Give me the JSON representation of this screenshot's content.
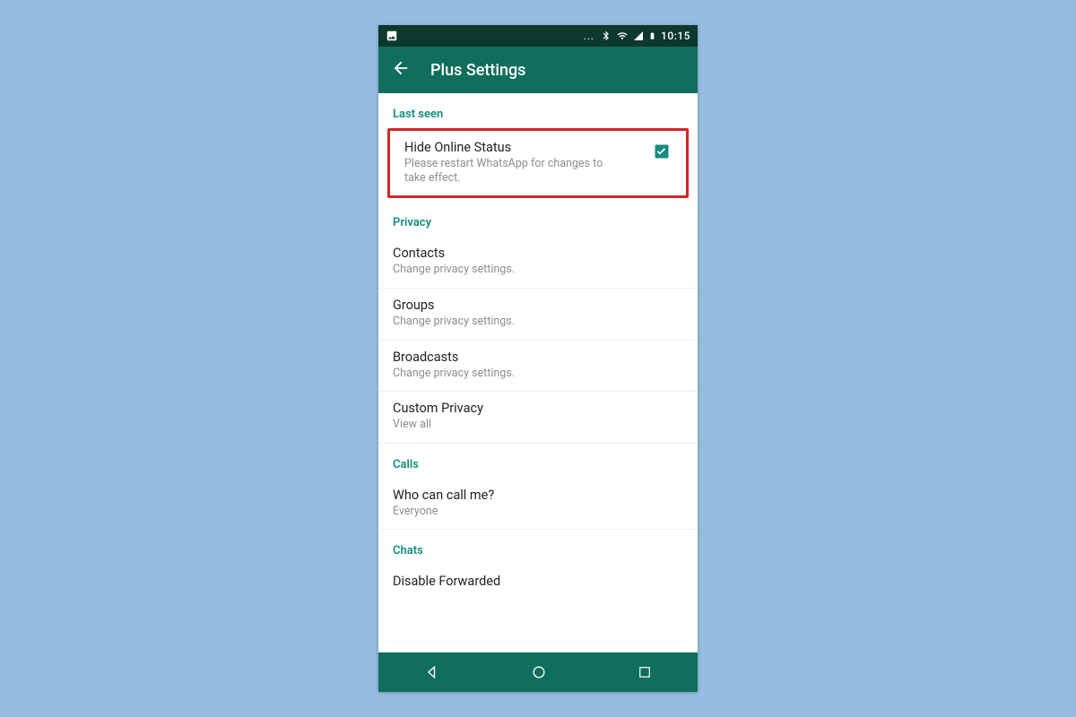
{
  "statusbar": {
    "ellipsis": "...",
    "time": "10:15"
  },
  "header": {
    "title": "Plus Settings"
  },
  "sections": {
    "lastSeen": {
      "header": "Last seen",
      "hideOnline": {
        "title": "Hide Online Status",
        "sub": "Please restart WhatsApp for changes to take effect.",
        "checked": true
      }
    },
    "privacy": {
      "header": "Privacy",
      "contacts": {
        "title": "Contacts",
        "sub": "Change privacy settings."
      },
      "groups": {
        "title": "Groups",
        "sub": "Change privacy settings."
      },
      "broadcasts": {
        "title": "Broadcasts",
        "sub": "Change privacy settings."
      },
      "customPrivacy": {
        "title": "Custom Privacy",
        "sub": "View all"
      }
    },
    "calls": {
      "header": "Calls",
      "whoCanCall": {
        "title": "Who can call me?",
        "sub": "Everyone"
      }
    },
    "chats": {
      "header": "Chats",
      "disableForwarded": {
        "title": "Disable Forwarded"
      }
    }
  },
  "colors": {
    "accent": "#128c7e",
    "appbar": "#0f6e5c",
    "statusbar": "#0c382e",
    "highlight": "#d32626"
  }
}
